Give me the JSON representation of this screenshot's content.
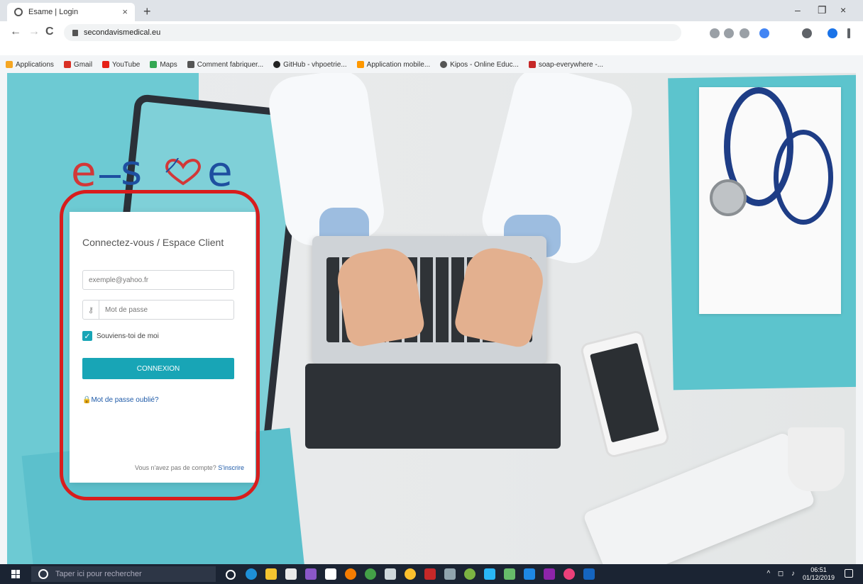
{
  "browser": {
    "tab_title": "Esame | Login",
    "tab_close": "×",
    "new_tab": "+",
    "url": "secondavismedical.eu",
    "nav": {
      "back": "←",
      "forward": "→",
      "reload": "C"
    },
    "window_controls": {
      "minimize": "–",
      "maximize": "❐",
      "close": "×"
    },
    "bookmarks": [
      {
        "label": "Applications",
        "color": "#f5a623"
      },
      {
        "label": "Gmail",
        "color": "#d93025"
      },
      {
        "label": "YouTube",
        "color": "#e62117"
      },
      {
        "label": "Maps",
        "color": "#34a853"
      },
      {
        "label": "Comment fabriquer...",
        "color": "#555555"
      },
      {
        "label": "GitHub - vhpoetrie...",
        "color": "#222222"
      },
      {
        "label": "Application mobile...",
        "color": "#ff9800"
      },
      {
        "label": "Kipos - Online Educ...",
        "color": "#555555"
      },
      {
        "label": "soap-everywhere -...",
        "color": "#c62828"
      }
    ]
  },
  "logo": {
    "left": "e",
    "middle": "s",
    "right": "e",
    "alt": "e-santé"
  },
  "login": {
    "title": "Connectez-vous / Espace Client",
    "email_placeholder": "exemple@yahoo.fr",
    "password_placeholder": "Mot de passe",
    "remember_label": "Souviens-toi de moi",
    "remember_checked": true,
    "submit_label": "CONNEXION",
    "forgot_label": "Mot de passe oublié?",
    "signup_prompt": "Vous n'avez pas de compte?",
    "signup_link": "S'inscrire"
  },
  "taskbar": {
    "search_placeholder": "Taper ici pour rechercher",
    "time": "06:51",
    "date": "01/12/2019"
  },
  "colors": {
    "accent": "#18a5b6",
    "highlight_ring": "#d81d1d",
    "logo_red": "#d23838",
    "logo_blue": "#1e4fa0"
  }
}
